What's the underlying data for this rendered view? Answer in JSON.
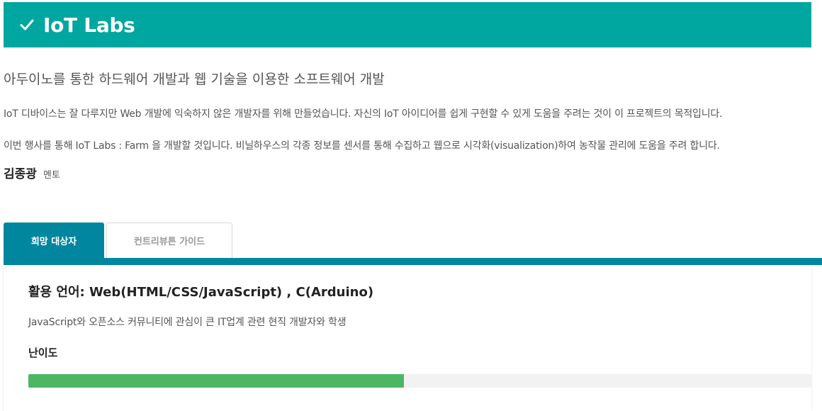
{
  "header": {
    "title": "IoT Labs",
    "icon": "check-icon",
    "background_color": "#00a7a0"
  },
  "subtitle": "아두이노를 통한 하드웨어 개발과 웹 기술을 이용한 소프트웨어 개발",
  "description": [
    "IoT 디바이스는 잘 다루지만 Web 개발에 익숙하지 않은 개발자를 위해 만들었습니다. 자신의 IoT 아이디어를 쉽게 구현할 수 있게 도움을 주려는 것이 이 프로젝트의 목적입니다.",
    "이번 행사를 통해 IoT Labs : Farm 을 개발할 것입니다. 비닐하우스의 각종 정보를 센서를 통해 수집하고 웹으로 시각화(visualization)하여 농작물 관리에 도움을 주려 합니다."
  ],
  "mentor": {
    "name": "김종광",
    "role": "멘토"
  },
  "tabs": [
    {
      "label": "희망 대상자",
      "active": true
    },
    {
      "label": "컨트리뷰튼 가이드",
      "active": false
    }
  ],
  "panel": {
    "languages": "활용 언어: Web(HTML/CSS/JavaScript) , C(Arduino)",
    "audience": "JavaScript와 오픈소스 커뮤니티에 관심이 큰 IT업계 관련 현직 개발자와 학생",
    "difficulty_label": "난이도",
    "difficulty_percent": 48
  },
  "colors": {
    "tab_active": "#00879f",
    "progress_fill": "#4cb663",
    "progress_track": "#f2f2f2"
  }
}
